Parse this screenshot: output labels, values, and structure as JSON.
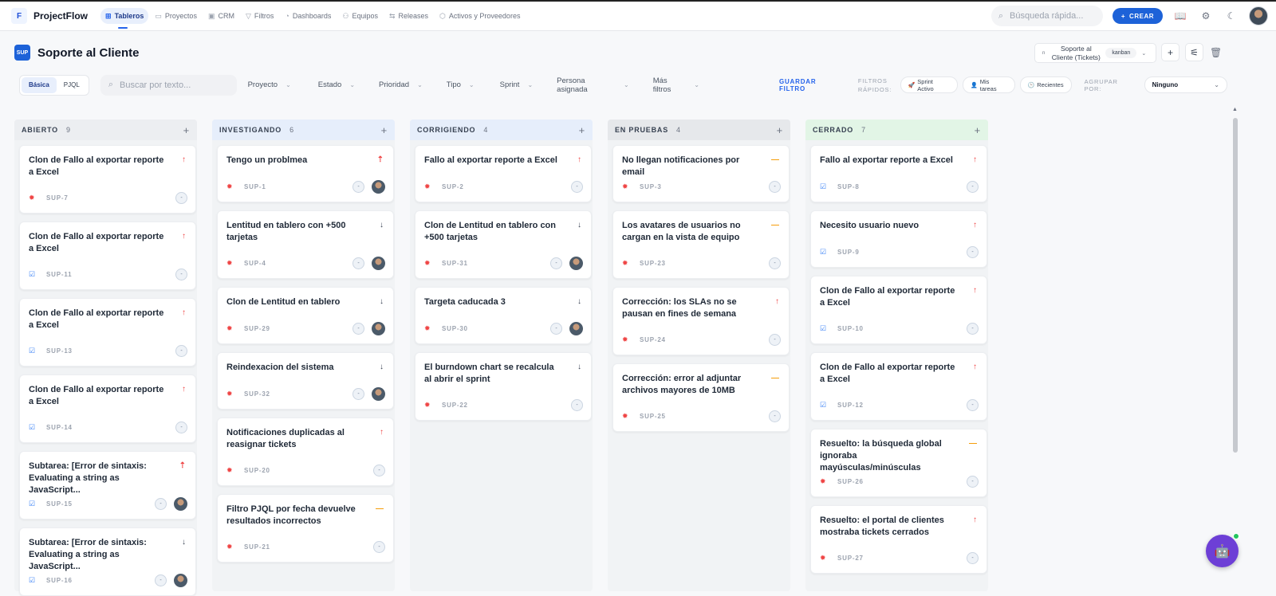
{
  "app": {
    "logo": "F",
    "name": "ProjectFlow"
  },
  "nav": [
    {
      "label": "Tableros",
      "icon": "board-icon",
      "glyph": "⊞"
    },
    {
      "label": "Proyectos",
      "icon": "folder-icon",
      "glyph": "▭"
    },
    {
      "label": "CRM",
      "icon": "briefcase-icon",
      "glyph": "▣"
    },
    {
      "label": "Filtros",
      "icon": "filter-icon",
      "glyph": "▽"
    },
    {
      "label": "Dashboards",
      "icon": "dashboard-icon",
      "glyph": "◔"
    },
    {
      "label": "Equipos",
      "icon": "users-icon",
      "glyph": "⚇"
    },
    {
      "label": "Releases",
      "icon": "release-icon",
      "glyph": "⇆"
    },
    {
      "label": "Activos y Proveedores",
      "icon": "box-icon",
      "glyph": "⬡"
    }
  ],
  "top": {
    "search_placeholder": "Búsqueda rápida...",
    "create_label": "CREAR"
  },
  "board": {
    "badge": "SUP",
    "title": "Soporte al Cliente",
    "view_select": {
      "prefix": "n",
      "project": "Soporte al Cliente (Tickets)",
      "view": "kanban"
    }
  },
  "filters": {
    "modes": [
      "Básica",
      "PJQL"
    ],
    "search_placeholder": "Buscar por texto...",
    "dropdowns": [
      "Proyecto",
      "Estado",
      "Prioridad",
      "Tipo",
      "Sprint",
      "Persona asignada",
      "Más filtros"
    ],
    "save_label": "GUARDAR FILTRO",
    "quick_label": "FILTROS RÁPIDOS:",
    "quick_chips": [
      {
        "glyph": "🚀",
        "label": "Sprint Activo"
      },
      {
        "glyph": "👤",
        "label": "Mis tareas"
      },
      {
        "glyph": "🕒",
        "label": "Recientes"
      }
    ],
    "group_label": "AGRUPAR POR:",
    "group_value": "Ninguno"
  },
  "columns": [
    {
      "name": "ABIERTO",
      "count": "9",
      "cards": [
        {
          "title": "Clon de Fallo al exportar reporte a Excel",
          "key": "SUP-7",
          "type": "bug",
          "priority": "up",
          "avatar": false
        },
        {
          "title": "Clon de Fallo al exportar reporte a Excel",
          "key": "SUP-11",
          "type": "task",
          "priority": "up",
          "avatar": false
        },
        {
          "title": "Clon de Fallo al exportar reporte a Excel",
          "key": "SUP-13",
          "type": "task",
          "priority": "up",
          "avatar": false
        },
        {
          "title": "Clon de Fallo al exportar reporte a Excel",
          "key": "SUP-14",
          "type": "task",
          "priority": "up",
          "avatar": false
        },
        {
          "title": "Subtarea: [Error de sintaxis: Evaluating a string as JavaScript...",
          "key": "SUP-15",
          "type": "task",
          "priority": "highest",
          "avatar": true
        },
        {
          "title": "Subtarea: [Error de sintaxis: Evaluating a string as JavaScript...",
          "key": "SUP-16",
          "type": "task",
          "priority": "down",
          "avatar": true
        }
      ]
    },
    {
      "name": "INVESTIGANDO",
      "count": "6",
      "cards": [
        {
          "title": "Tengo un problmea",
          "key": "SUP-1",
          "type": "bug",
          "priority": "highest",
          "avatar": true
        },
        {
          "title": "Lentitud en tablero con +500 tarjetas",
          "key": "SUP-4",
          "type": "bug",
          "priority": "down",
          "avatar": true
        },
        {
          "title": "Clon de Lentitud en tablero",
          "key": "SUP-29",
          "type": "bug",
          "priority": "down",
          "avatar": true
        },
        {
          "title": "Reindexacion del sistema",
          "key": "SUP-32",
          "type": "bug",
          "priority": "down",
          "avatar": true
        },
        {
          "title": "Notificaciones duplicadas al reasignar tickets",
          "key": "SUP-20",
          "type": "bug",
          "priority": "up",
          "avatar": false
        },
        {
          "title": "Filtro PJQL por fecha devuelve resultados incorrectos",
          "key": "SUP-21",
          "type": "bug",
          "priority": "med",
          "avatar": false
        }
      ]
    },
    {
      "name": "CORRIGIENDO",
      "count": "4",
      "cards": [
        {
          "title": "Fallo al exportar reporte a Excel",
          "key": "SUP-2",
          "type": "bug",
          "priority": "up",
          "avatar": false
        },
        {
          "title": "Clon de Lentitud en tablero con +500 tarjetas",
          "key": "SUP-31",
          "type": "bug",
          "priority": "down",
          "avatar": true
        },
        {
          "title": "Targeta caducada 3",
          "key": "SUP-30",
          "type": "bug",
          "priority": "down",
          "avatar": true
        },
        {
          "title": "El burndown chart se recalcula al abrir el sprint",
          "key": "SUP-22",
          "type": "bug",
          "priority": "down",
          "avatar": false
        }
      ]
    },
    {
      "name": "EN PRUEBAS",
      "count": "4",
      "cards": [
        {
          "title": "No llegan notificaciones por email",
          "key": "SUP-3",
          "type": "bug",
          "priority": "med",
          "avatar": false
        },
        {
          "title": "Los avatares de usuarios no cargan en la vista de equipo",
          "key": "SUP-23",
          "type": "bug",
          "priority": "med",
          "avatar": false
        },
        {
          "title": "Corrección: los SLAs no se pausan en fines de semana",
          "key": "SUP-24",
          "type": "bug",
          "priority": "up",
          "avatar": false
        },
        {
          "title": "Corrección: error al adjuntar archivos mayores de 10MB",
          "key": "SUP-25",
          "type": "bug",
          "priority": "med",
          "avatar": false
        }
      ]
    },
    {
      "name": "CERRADO",
      "count": "7",
      "cards": [
        {
          "title": "Fallo al exportar reporte a Excel",
          "key": "SUP-8",
          "type": "task",
          "priority": "up",
          "avatar": false
        },
        {
          "title": "Necesito usuario nuevo",
          "key": "SUP-9",
          "type": "task",
          "priority": "up",
          "avatar": false
        },
        {
          "title": "Clon de Fallo al exportar reporte a Excel",
          "key": "SUP-10",
          "type": "task",
          "priority": "up",
          "avatar": false
        },
        {
          "title": "Clon de Fallo al exportar reporte a Excel",
          "key": "SUP-12",
          "type": "task",
          "priority": "up",
          "avatar": false
        },
        {
          "title": "Resuelto: la búsqueda global ignoraba mayúsculas/minúsculas",
          "key": "SUP-26",
          "type": "bug",
          "priority": "med",
          "avatar": false
        },
        {
          "title": "Resuelto: el portal de clientes mostraba tickets cerrados",
          "key": "SUP-27",
          "type": "bug",
          "priority": "up",
          "avatar": false
        }
      ]
    }
  ],
  "assignee_placeholder": "-",
  "colors": {
    "accent": "#1d62d8",
    "bug": "#ef4444",
    "task": "#3b82f6",
    "medium": "#f59e0b",
    "bot": "#6d3fd6"
  }
}
